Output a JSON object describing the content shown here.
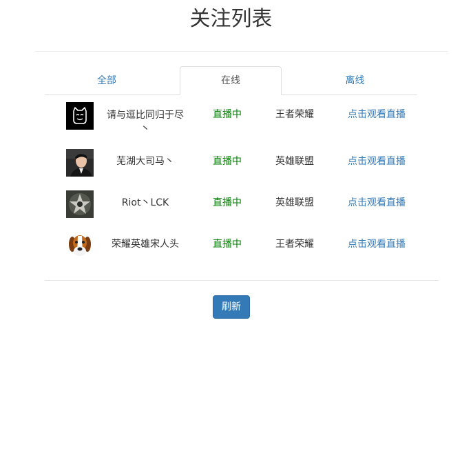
{
  "page_title": "关注列表",
  "tabs": [
    {
      "label": "全部",
      "active": false
    },
    {
      "label": "在线",
      "active": true
    },
    {
      "label": "离线",
      "active": false
    }
  ],
  "streamers": [
    {
      "name": "请与逗比同归于尽丶",
      "status": "直播中",
      "game": "王者荣耀",
      "action": "点击观看直播",
      "avatar": "cat-face-avatar"
    },
    {
      "name": "芜湖大司马丶",
      "status": "直播中",
      "game": "英雄联盟",
      "action": "点击观看直播",
      "avatar": "man-portrait-avatar"
    },
    {
      "name": "Riot丶LCK",
      "status": "直播中",
      "game": "英雄联盟",
      "action": "点击观看直播",
      "avatar": "star-logo-avatar"
    },
    {
      "name": "荣耀英雄宋人头",
      "status": "直播中",
      "game": "王者荣耀",
      "action": "点击观看直播",
      "avatar": "beagle-dog-avatar"
    }
  ],
  "refresh_label": "刷新",
  "colors": {
    "link": "#337ab7",
    "live": "#008000",
    "button": "#337ab7"
  }
}
